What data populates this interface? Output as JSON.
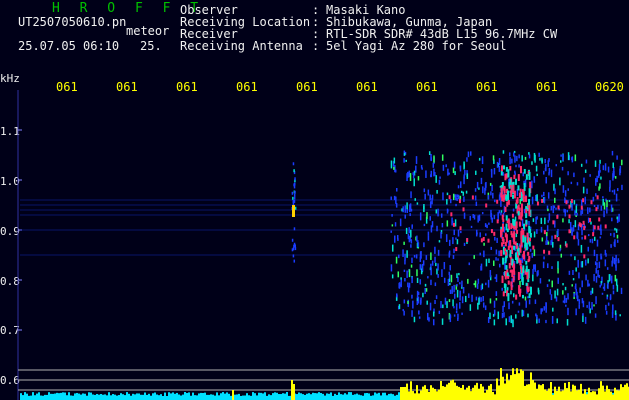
{
  "header": {
    "title": "H R O F F T",
    "filename": "UT2507050610.pn",
    "event_label": "meteor",
    "datetime": "25.07.05 06:10",
    "datetime_extra": "25.",
    "fields": [
      {
        "label": "Observer",
        "value": "Masaki Kano"
      },
      {
        "label": "Receiving Location",
        "value": "Shibukawa, Gunma, Japan"
      },
      {
        "label": "Receiver",
        "value": "RTL-SDR SDR# 43dB L15 96.7MHz CW"
      },
      {
        "label": "Receiving Antenna",
        "value": "5el Yagi Az 280 for Seoul"
      }
    ],
    "colon": ":"
  },
  "axes": {
    "y_unit": "kHz",
    "x_ticks": [
      "061",
      "061",
      "061",
      "061",
      "061",
      "061",
      "061",
      "061",
      "061",
      "0620"
    ],
    "y_ticks": [
      "1.1",
      "1.0",
      "0.9",
      "0.8",
      "0.7",
      "0.6"
    ]
  },
  "colors": {
    "background": "#000018",
    "title": "#00c000",
    "text_yellow": "#ffff00",
    "text_white": "#f0f0f0",
    "noise": "#1a3cff",
    "signal_mid": "#00e0d0",
    "signal_hot": "#ff2a6a",
    "meter_yellow": "#ffff00",
    "meter_cyan": "#00e0ff"
  }
}
